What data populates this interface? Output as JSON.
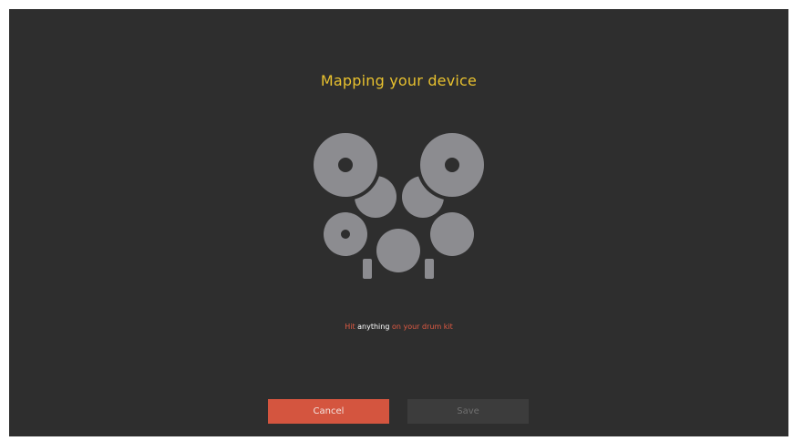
{
  "header": {
    "title": "Mapping your device"
  },
  "hint": {
    "part1": "Hit",
    "part2": "anything",
    "part3": "on your drum kit"
  },
  "buttons": {
    "cancel_label": "Cancel",
    "save_label": "Save"
  },
  "colors": {
    "background": "#2e2e2e",
    "title": "#e8c12e",
    "drum": "#8c8c90",
    "cancel": "#d4553f",
    "save_disabled": "#3c3c3c",
    "hint_highlight": "#ffffff",
    "hint_text": "#e05a43"
  },
  "icons": {
    "illustration": "drum-kit-icon"
  }
}
